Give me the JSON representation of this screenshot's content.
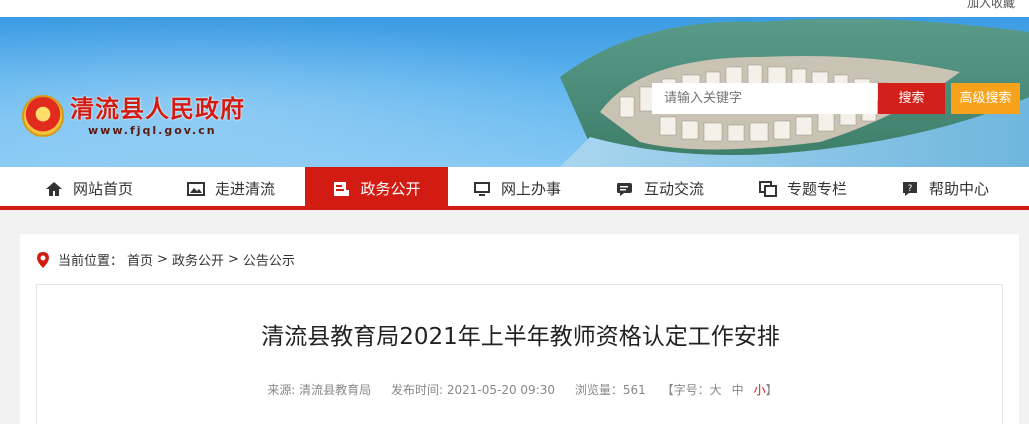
{
  "topbar": {
    "favorite_label": "加入收藏"
  },
  "site": {
    "name": "清流县人民政府",
    "url": "www.fjql.gov.cn"
  },
  "search": {
    "placeholder": "请输入关键字",
    "button_label": "搜索",
    "advanced_label": "高级搜索"
  },
  "nav": {
    "items": [
      {
        "label": "网站首页",
        "icon": "home-icon"
      },
      {
        "label": "走进清流",
        "icon": "image-icon"
      },
      {
        "label": "政务公开",
        "icon": "document-icon",
        "active": true
      },
      {
        "label": "网上办事",
        "icon": "monitor-icon"
      },
      {
        "label": "互动交流",
        "icon": "chat-icon"
      },
      {
        "label": "专题专栏",
        "icon": "layers-icon"
      },
      {
        "label": "帮助中心",
        "icon": "help-icon"
      }
    ]
  },
  "breadcrumb": {
    "prefix": "当前位置：",
    "items": [
      "首页",
      "政务公开",
      "公告公示"
    ],
    "separator": ">"
  },
  "article": {
    "title": "清流县教育局2021年上半年教师资格认定工作安排",
    "source": "来源: 清流县教育局",
    "published": "发布时间: 2021-05-20 09:30",
    "views": "浏览量：561",
    "font_size_label": "【字号：",
    "font_large": "大",
    "font_medium": "中",
    "font_small": "小",
    "font_close": "】"
  },
  "colors": {
    "brand_red": "#d21c13",
    "accent_orange": "#f7a21b",
    "banner_blue": "#4aa8e8"
  }
}
